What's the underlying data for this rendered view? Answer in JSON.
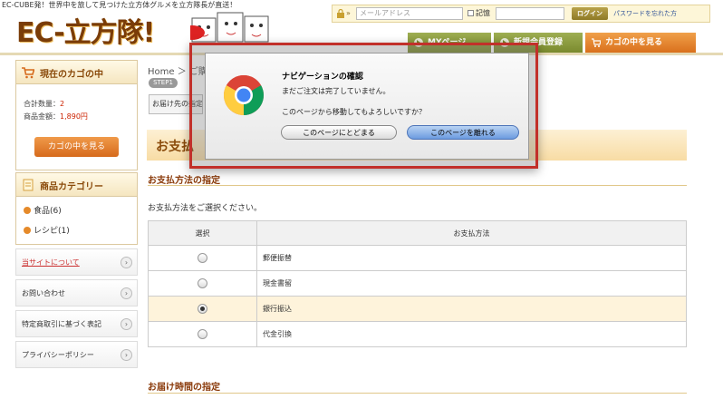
{
  "header": {
    "tagline": "EC-CUBE発！世界中を旅して見つけた立方体グルメを立方隊長が直送！",
    "logo_text": "EC-立方隊!",
    "login": {
      "email_placeholder": "メールアドレス",
      "remember_label": "記憶",
      "login_button": "ログイン",
      "forgot_link": "パスワードを忘れた方"
    },
    "nav": {
      "mypage": "MYページ",
      "register": "新規会員登録",
      "cart": "カゴの中を見る"
    }
  },
  "sidebar": {
    "cart": {
      "title": "現在のカゴの中",
      "quantity_label": "合計数量：",
      "quantity_value": "2",
      "amount_label": "商品金額：",
      "amount_value": "1,890円",
      "view_button": "カゴの中を見る"
    },
    "categories": {
      "title": "商品カテゴリー",
      "items": [
        "食品(6)",
        "レシピ(1)"
      ]
    },
    "links": [
      "当サイトについて",
      "お問い合わせ",
      "特定商取引に基づく表記",
      "プライバシーポリシー"
    ]
  },
  "main": {
    "breadcrumb": "Home ＞ ご購",
    "step_badge": "STEP1",
    "step_label": "お届け先の指定",
    "page_title": "お支払",
    "payment_section": "お支払方法の指定",
    "payment_instruction": "お支払方法をご選択ください。",
    "payment_table": {
      "col_select": "選択",
      "col_method": "お支払方法",
      "methods": [
        {
          "label": "郵便振替",
          "selected": false
        },
        {
          "label": "現金書留",
          "selected": false
        },
        {
          "label": "銀行振込",
          "selected": true
        },
        {
          "label": "代金引換",
          "selected": false
        }
      ]
    },
    "delivery_section": "お届け時間の指定"
  },
  "dialog": {
    "title": "ナビゲーションの確認",
    "message1": "まだご注文は完了していません。",
    "message2": "このページから移動してもよろしいですか？",
    "stay_button": "このページにとどまる",
    "leave_button": "このページを離れる"
  }
}
